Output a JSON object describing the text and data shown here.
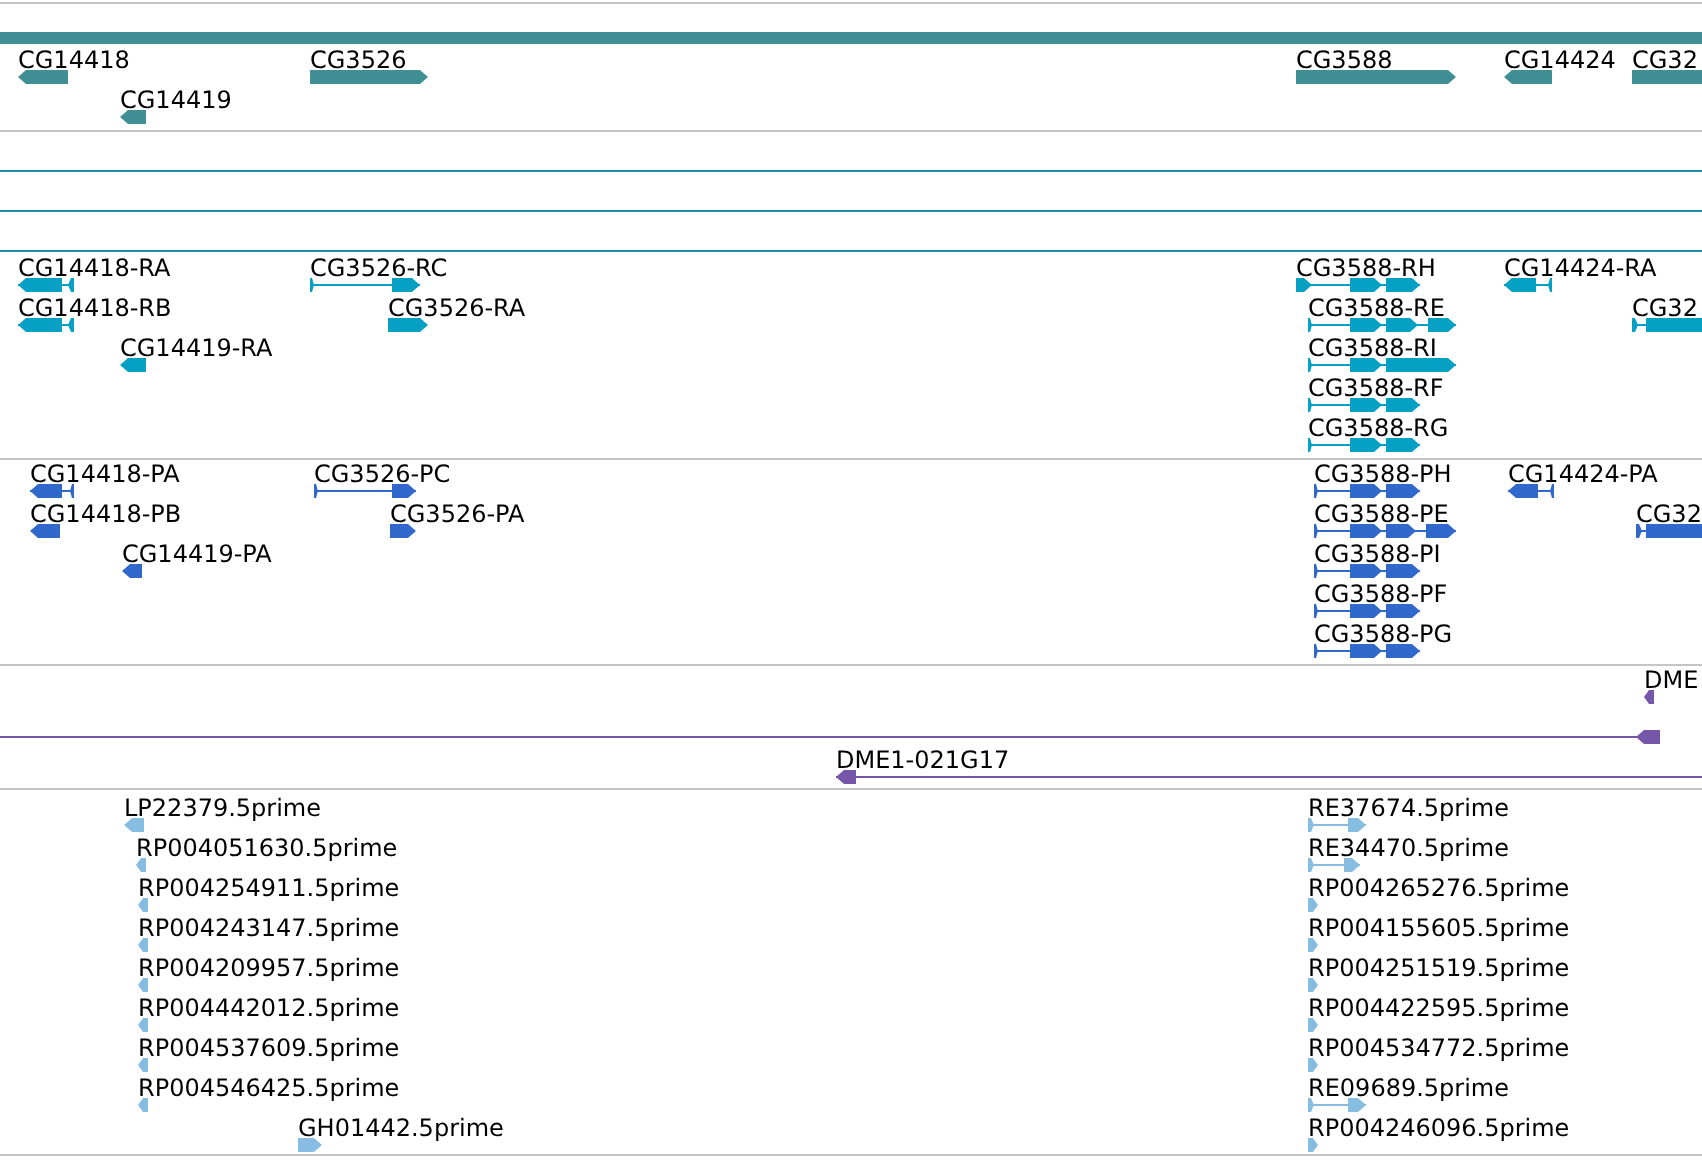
{
  "tracks": [
    {
      "kind": "genes",
      "color": "#3f8f94",
      "features": [
        {
          "label": "CG14418",
          "reverse": true
        },
        {
          "label": "CG14419",
          "reverse": true
        },
        {
          "label": "CG3526",
          "reverse": false
        },
        {
          "label": "CG3588",
          "reverse": false
        },
        {
          "label": "CG14424",
          "reverse": true
        },
        {
          "label": "CG32",
          "reverse": false
        }
      ]
    },
    {
      "kind": "blank",
      "color": "#1b8fb0"
    },
    {
      "kind": "transcripts",
      "color": "#05a0c4",
      "features": [
        {
          "label": "CG14418-RA",
          "reverse": true
        },
        {
          "label": "CG14418-RB",
          "reverse": true
        },
        {
          "label": "CG14419-RA",
          "reverse": true
        },
        {
          "label": "CG3526-RC",
          "reverse": false
        },
        {
          "label": "CG3526-RA",
          "reverse": false
        },
        {
          "label": "CG3588-RH",
          "reverse": false
        },
        {
          "label": "CG3588-RE",
          "reverse": false
        },
        {
          "label": "CG3588-RI",
          "reverse": false
        },
        {
          "label": "CG3588-RF",
          "reverse": false
        },
        {
          "label": "CG3588-RG",
          "reverse": false
        },
        {
          "label": "CG14424-RA",
          "reverse": true
        },
        {
          "label": "CG32",
          "reverse": false
        }
      ]
    },
    {
      "kind": "proteins",
      "color": "#3068cc",
      "features": [
        {
          "label": "CG14418-PA",
          "reverse": true
        },
        {
          "label": "CG14418-PB",
          "reverse": true
        },
        {
          "label": "CG14419-PA",
          "reverse": true
        },
        {
          "label": "CG3526-PC",
          "reverse": false
        },
        {
          "label": "CG3526-PA",
          "reverse": false
        },
        {
          "label": "CG3588-PH",
          "reverse": false
        },
        {
          "label": "CG3588-PE",
          "reverse": false
        },
        {
          "label": "CG3588-PI",
          "reverse": false
        },
        {
          "label": "CG3588-PF",
          "reverse": false
        },
        {
          "label": "CG3588-PG",
          "reverse": false
        },
        {
          "label": "CG14424-PA",
          "reverse": true
        },
        {
          "label": "CG32",
          "reverse": false
        }
      ]
    },
    {
      "kind": "clones",
      "color": "#7656a8",
      "features": [
        {
          "label": "DME",
          "reverse": true
        },
        {
          "reverse": true
        },
        {
          "label": "DME1-021G17",
          "reverse": true
        }
      ]
    },
    {
      "kind": "ests",
      "color": "#88bde2",
      "features": [
        {
          "label": "LP22379.5prime",
          "reverse": true
        },
        {
          "label": "RP004051630.5prime",
          "reverse": true
        },
        {
          "label": "RP004254911.5prime",
          "reverse": true
        },
        {
          "label": "RP004243147.5prime",
          "reverse": true
        },
        {
          "label": "RP004209957.5prime",
          "reverse": true
        },
        {
          "label": "RP004442012.5prime",
          "reverse": true
        },
        {
          "label": "RP004537609.5prime",
          "reverse": true
        },
        {
          "label": "RP004546425.5prime",
          "reverse": true
        },
        {
          "label": "GH01442.5prime",
          "reverse": false
        },
        {
          "label": "RE37674.5prime",
          "reverse": false
        },
        {
          "label": "RE34470.5prime",
          "reverse": false
        },
        {
          "label": "RP004265276.5prime",
          "reverse": false
        },
        {
          "label": "RP004155605.5prime",
          "reverse": false
        },
        {
          "label": "RP004251519.5prime",
          "reverse": false
        },
        {
          "label": "RP004422595.5prime",
          "reverse": false
        },
        {
          "label": "RP004534772.5prime",
          "reverse": false
        },
        {
          "label": "RE09689.5prime",
          "reverse": false
        },
        {
          "label": "RP004246096.5prime",
          "reverse": false
        }
      ]
    }
  ]
}
